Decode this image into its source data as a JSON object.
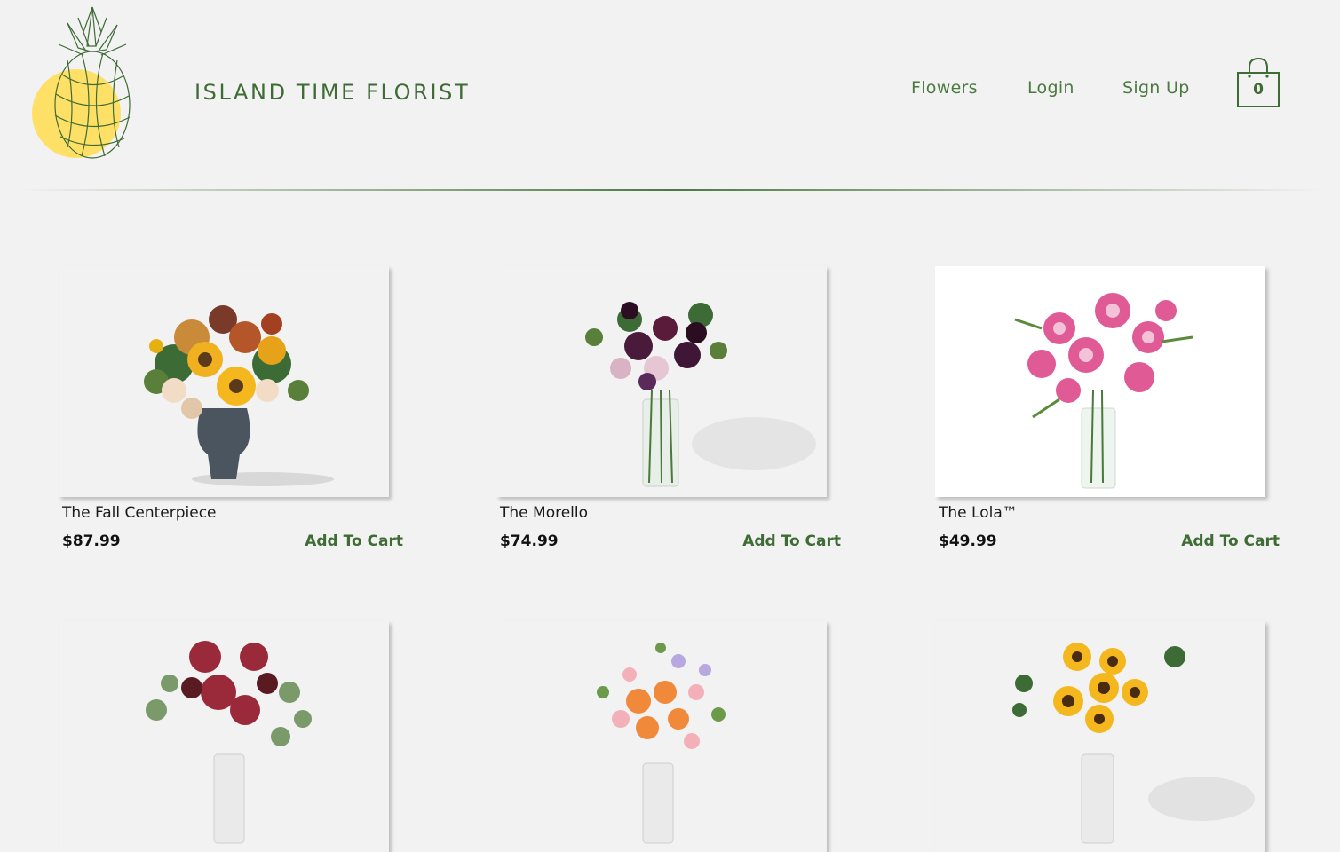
{
  "brand": {
    "name": "ISLAND TIME FLORIST",
    "logo_icon": "pineapple-logo-icon",
    "logo_accent": "#ffe066",
    "line_color": "#3f6b35"
  },
  "nav": {
    "flowers": "Flowers",
    "login": "Login",
    "signup": "Sign Up"
  },
  "cart": {
    "icon": "shopping-bag-icon",
    "count": "0"
  },
  "products": [
    {
      "name": "The Fall Centerpiece",
      "price": "$87.99",
      "action": "Add To Cart",
      "image": "fall-centerpiece-bouquet"
    },
    {
      "name": "The Morello",
      "price": "$74.99",
      "action": "Add To Cart",
      "image": "morello-bouquet"
    },
    {
      "name": "The Lola™",
      "price": "$49.99",
      "action": "Add To Cart",
      "image": "lola-lily-bouquet"
    },
    {
      "name": "",
      "price": "",
      "action": "",
      "image": "protea-bouquet"
    },
    {
      "name": "",
      "price": "",
      "action": "",
      "image": "rose-snapdragon-bouquet"
    },
    {
      "name": "",
      "price": "",
      "action": "",
      "image": "sunflower-bouquet"
    }
  ],
  "colors": {
    "background": "#f2f2f2",
    "accent": "#3f6b35",
    "text": "#1a1a1a"
  }
}
